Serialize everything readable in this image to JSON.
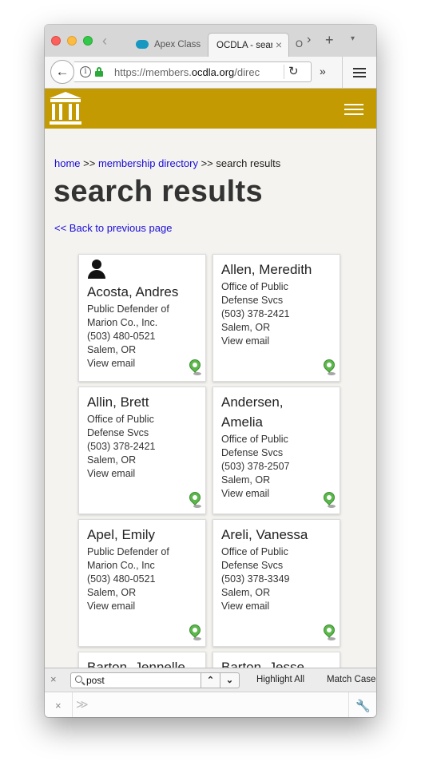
{
  "browser": {
    "tabs": [
      {
        "title": "Apex Class"
      },
      {
        "title": "OCDLA - search"
      },
      {
        "title": "O"
      }
    ],
    "active_tab_close": "×",
    "tab_overflow": "›",
    "new_tab": "+",
    "tab_list": "▾",
    "url_prefix": "https://members.",
    "url_host": "ocdla.org",
    "url_path": "/direc",
    "back": "←",
    "reload": "↻",
    "overflow": "»"
  },
  "page": {
    "breadcrumb": {
      "home": "home",
      "sep1": " >> ",
      "directory": "membership directory",
      "sep2": " >> ",
      "current": "search results"
    },
    "title": "search results",
    "back_link": "<< Back to previous page",
    "colors": {
      "header": "#c39a02",
      "link": "#1a0dd8",
      "pin": "#5cb74c"
    },
    "cards": [
      {
        "name": "Acosta, Andres",
        "lines": [
          "Public Defender of",
          "Marion Co., Inc.",
          "(503) 480-0521",
          "Salem, OR",
          "View email"
        ],
        "avatar": true
      },
      {
        "name": "Allen, Meredith",
        "lines": [
          "Office of Public",
          "Defense Svcs",
          "(503) 378-2421",
          "Salem, OR",
          "View email"
        ]
      },
      {
        "name": "Allin, Brett",
        "lines": [
          "Office of Public",
          "Defense Svcs",
          "(503) 378-2421",
          "Salem, OR",
          "View email"
        ]
      },
      {
        "name": "Andersen, Amelia",
        "lines": [
          "Office of Public",
          "Defense Svcs",
          "(503) 378-2507",
          "Salem, OR",
          "View email"
        ]
      },
      {
        "name": "Apel, Emily",
        "lines": [
          "Public Defender of",
          "Marion Co., Inc",
          "(503) 480-0521",
          "Salem, OR",
          "View email"
        ]
      },
      {
        "name": "Areli, Vanessa",
        "lines": [
          "Office of Public",
          "Defense Svcs",
          "(503) 378-3349",
          "Salem, OR",
          "View email"
        ]
      },
      {
        "name": "Barton, Jennelle",
        "lines": []
      },
      {
        "name": "Barton, Jesse",
        "lines": []
      }
    ]
  },
  "findbar": {
    "close": "×",
    "query": "post",
    "prev": "⌃",
    "next": "⌄",
    "highlight_all": "Highlight All",
    "match_case": "Match Case"
  },
  "devbar": {
    "close": "×",
    "prompt": "≫",
    "wrench": "🔧"
  }
}
